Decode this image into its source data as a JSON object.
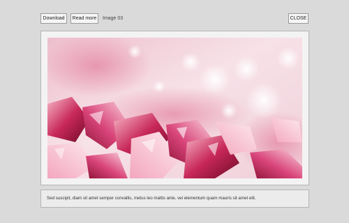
{
  "toolbar": {
    "download_label": "Download",
    "readmore_label": "Read more",
    "image_counter": "Image 03",
    "close_label": "CLOSE"
  },
  "photo": {
    "subject": "pink-crystals-photo"
  },
  "caption": {
    "text": "Sed suscipit, diam sit amet semper convallis, metus leo mattis ante, vel elementum quam mauris sit amet elit."
  },
  "colors": {
    "background": "#dadada",
    "panel": "#f3f3f3",
    "crystal_dark": "#a8163f",
    "crystal_light": "#f6c8d4"
  }
}
